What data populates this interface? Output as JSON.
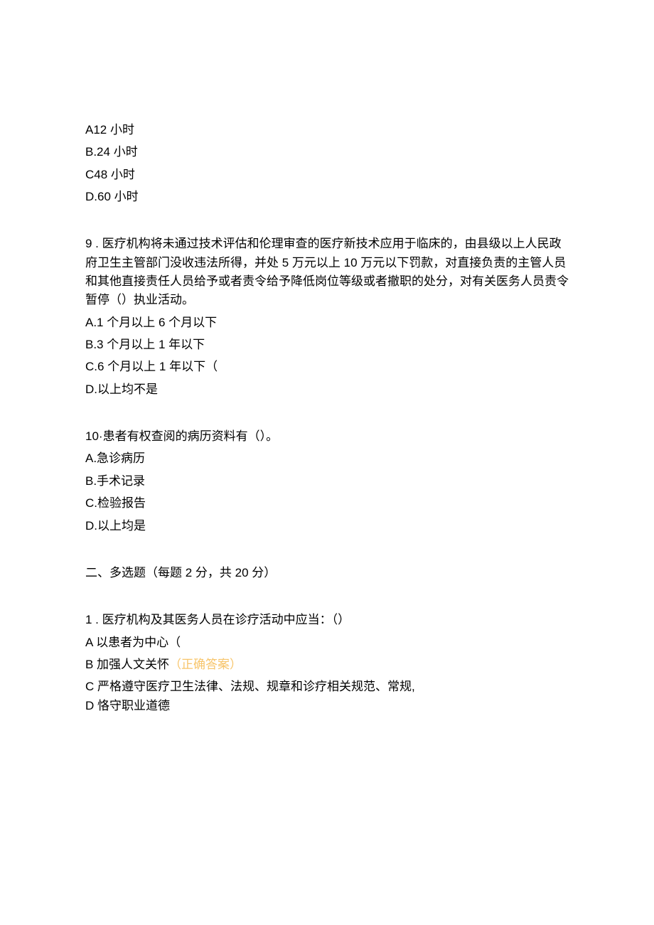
{
  "q8_options": {
    "a": "A12 小时",
    "b": "B.24 小时",
    "c": "C48 小时",
    "d": "D.60 小时"
  },
  "q9": {
    "text": "9 . 医疗机构将未通过技术评估和伦理审查的医疗新技术应用于临床的，由县级以上人民政府卫生主管部门没收违法所得，并处 5 万元以上 10 万元以下罚款，对直接负责的主管人员和其他直接责任人员给予或者责令给予降低岗位等级或者撤职的处分，对有关医务人员责令暂停（）执业活动。",
    "a": "A.1 个月以上 6 个月以下",
    "b": "B.3 个月以上 1 年以下",
    "c": "C.6 个月以上 1 年以下（",
    "d": "D.以上均不是"
  },
  "q10": {
    "text": "10·患者有权查阅的病历资料有（）。",
    "a": "A.急诊病历",
    "b": "B.手术记录",
    "c": "C.检验报告",
    "d": "D.以上均是"
  },
  "section2": {
    "heading": "二、多选题（每题 2 分，共 20 分）"
  },
  "s2q1": {
    "text": "1 . 医疗机构及其医务人员在诊疗活动中应当：（）",
    "a": "A 以患者为中心（",
    "b_prefix": "B 加强人文关怀",
    "b_correct": "（正确答案）",
    "c": "C 严格遵守医疗卫生法律、法规、规章和诊疗相关规范、常规,",
    "d": "D 恪守职业道德"
  }
}
